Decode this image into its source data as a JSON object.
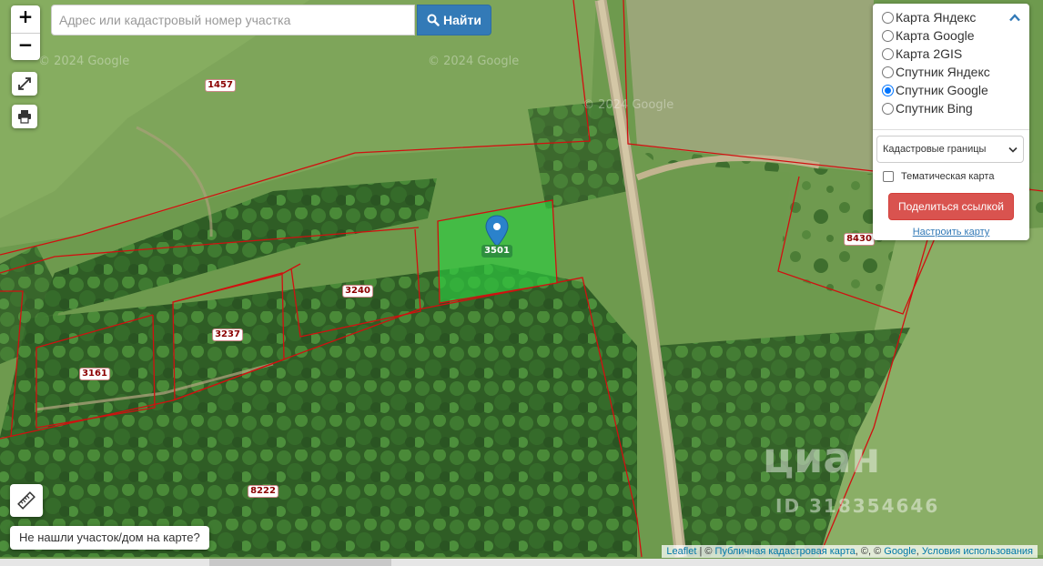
{
  "search": {
    "placeholder": "Адрес или кадастровый номер участка",
    "button_label": "Найти",
    "button_icon": "search-icon"
  },
  "zoom": {
    "in_label": "+",
    "out_label": "−"
  },
  "tools": {
    "fullscreen_icon": "expand-icon",
    "print_icon": "print-icon",
    "measure_icon": "ruler-icon"
  },
  "layers": {
    "options": [
      {
        "label": "Карта Яндекс",
        "checked": false
      },
      {
        "label": "Карта Google",
        "checked": false
      },
      {
        "label": "Карта 2GIS",
        "checked": false
      },
      {
        "label": "Спутник Яндекс",
        "checked": false
      },
      {
        "label": "Спутник Google",
        "checked": true
      },
      {
        "label": "Спутник Bing",
        "checked": false
      }
    ],
    "overlay_select": "Кадастровые границы",
    "thematic_label": "Тематическая карта",
    "thematic_checked": false,
    "share_button": "Поделиться ссылкой",
    "settings_link": "Настроить карту"
  },
  "parcels": [
    {
      "label": "1457"
    },
    {
      "label": "3240"
    },
    {
      "label": "3237"
    },
    {
      "label": "3161"
    },
    {
      "label": "3501",
      "selected": true
    },
    {
      "label": "8430"
    },
    {
      "label": "8222"
    }
  ],
  "not_found_button": "Не нашли участок/дом на карте?",
  "attribution": {
    "leaflet": "Leaflet",
    "separator": " | © ",
    "source": "Публичная кадастровая карта",
    "mid": ", ©, © ",
    "google": "Google",
    "comma": ", ",
    "terms": "Условия использования"
  },
  "watermark": {
    "brand": "циан",
    "listing_id": "ID 318354646"
  },
  "imagery_copyright": "© 2024 Google",
  "colors": {
    "selected_parcel": "#2ecc40",
    "parcel_border": "#d01010",
    "search_button": "#337ab7",
    "share_button": "#d9534f"
  }
}
